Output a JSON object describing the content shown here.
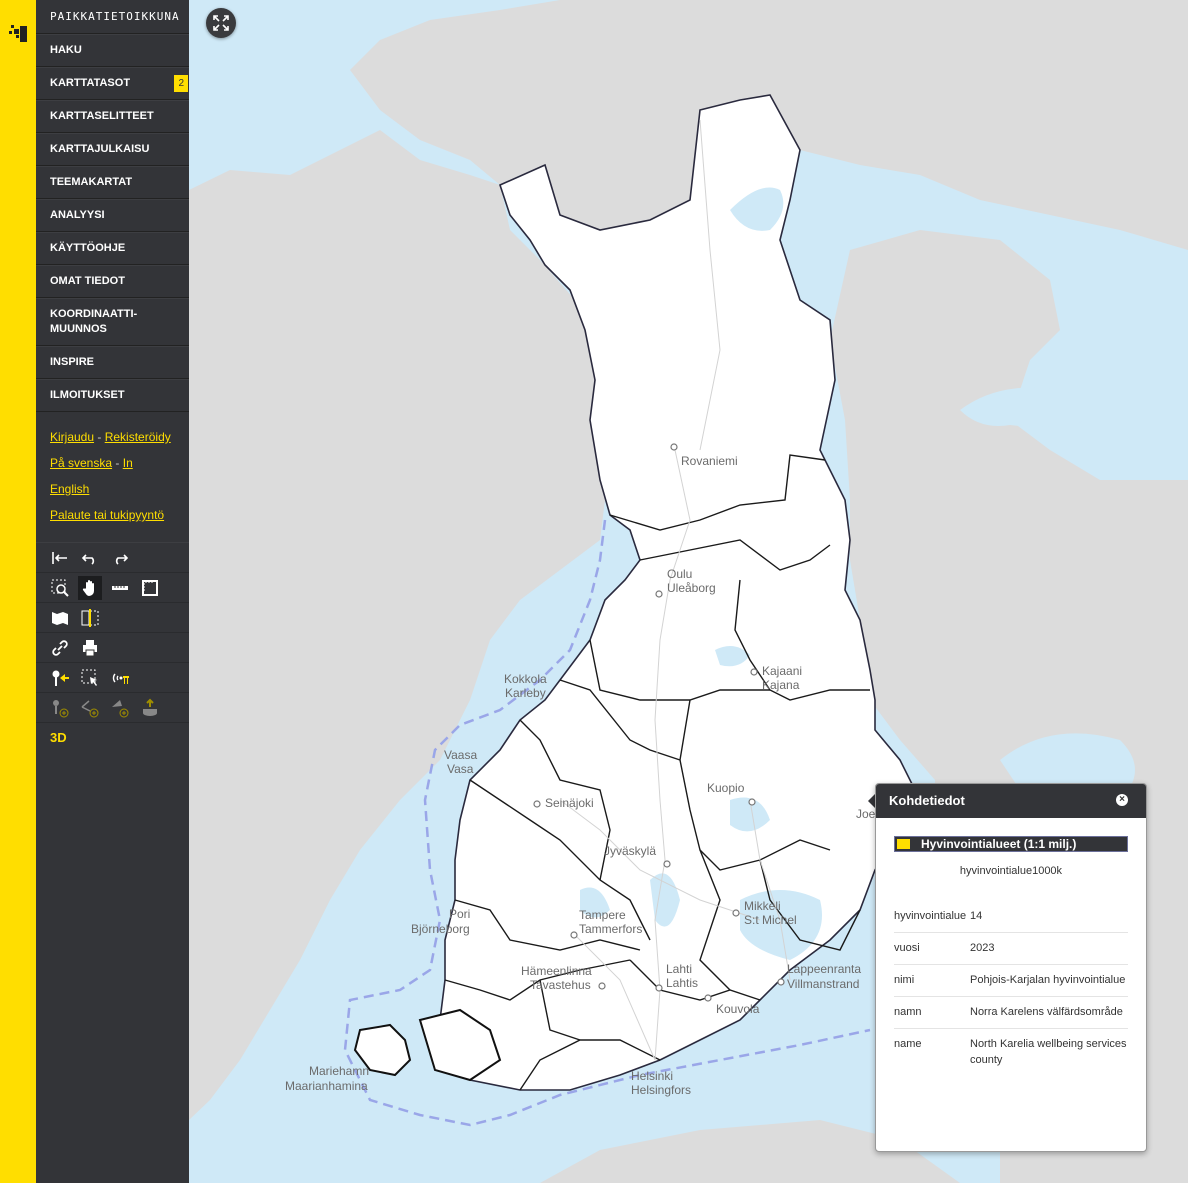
{
  "app": {
    "title": "PAIKKATIETOIKKUNA"
  },
  "menu": [
    {
      "label": "HAKU"
    },
    {
      "label": "KARTTATASOT",
      "badge": "2"
    },
    {
      "label": "KARTTASELITTEET"
    },
    {
      "label": "KARTTAJULKAISU"
    },
    {
      "label": "TEEMAKARTAT"
    },
    {
      "label": "ANALYYSI"
    },
    {
      "label": "KÄYTTÖOHJE"
    },
    {
      "label": "OMAT TIEDOT"
    },
    {
      "label": "KOORDINAATTI-\nMUUNNOS"
    },
    {
      "label": "INSPIRE"
    },
    {
      "label": "ILMOITUKSET"
    }
  ],
  "links": {
    "login": "Kirjaudu",
    "register": "Rekisteröidy",
    "swedish": "På svenska",
    "english": "In English",
    "feedback": "Palaute tai tukipyyntö",
    "separator": "-"
  },
  "tools": {
    "rows": [
      [
        "reset-view-icon",
        "undo-icon",
        "redo-icon"
      ],
      [
        "zoom-box-icon",
        "pan-hand-icon",
        "measure-line-icon",
        "measure-area-icon"
      ],
      [
        "map-book-icon",
        "split-compare-icon"
      ],
      [
        "link-icon",
        "print-icon"
      ],
      [
        "place-marker-icon",
        "select-features-icon",
        "gps-icon"
      ],
      [
        "add-point-icon",
        "add-line-icon",
        "add-area-icon",
        "import-icon"
      ]
    ],
    "three_d_label": "3D",
    "active_tool": "pan-hand-icon"
  },
  "map": {
    "cities": [
      {
        "label": "Rovaniemi"
      },
      {
        "label": "Oulu"
      },
      {
        "label": "Uleåborg"
      },
      {
        "label": "Kajaani"
      },
      {
        "label": "Kajana"
      },
      {
        "label": "Kokkola"
      },
      {
        "label": "Karleby"
      },
      {
        "label": "Vaasa"
      },
      {
        "label": "Vasa"
      },
      {
        "label": "Kuopio"
      },
      {
        "label": "Seinäjoki"
      },
      {
        "label": "Jyväskylä"
      },
      {
        "label": "Joensuu"
      },
      {
        "label": "Mikkeli"
      },
      {
        "label": "S:t Michel"
      },
      {
        "label": "Pori"
      },
      {
        "label": "Björneborg"
      },
      {
        "label": "Tampere"
      },
      {
        "label": "Tammerfors"
      },
      {
        "label": "Hämeenlinna"
      },
      {
        "label": "Tavastehus"
      },
      {
        "label": "Lahti"
      },
      {
        "label": "Lahtis"
      },
      {
        "label": "Lappeenranta"
      },
      {
        "label": "Villmanstrand"
      },
      {
        "label": "Kouvola"
      },
      {
        "label": "Helsinki"
      },
      {
        "label": "Helsingfors"
      },
      {
        "label": "Mariehamn"
      },
      {
        "label": "Maarianhamina"
      }
    ],
    "colors": {
      "sea": "#cfe9f7",
      "foreign_land": "#dcdcdc",
      "finland": "#ffffff",
      "region_border": "#1a1a1a",
      "sea_border": "#9aa6e8",
      "accent": "#ffde00"
    }
  },
  "popup": {
    "title": "Kohdetiedot",
    "layer_title": "Hyvinvointialueet (1:1 milj.)",
    "layer_id": "hyvinvointialue1000k",
    "attributes": [
      {
        "key": "hyvinvointialue",
        "value": "14"
      },
      {
        "key": "vuosi",
        "value": "2023"
      },
      {
        "key": "nimi",
        "value": "Pohjois-Karjalan hyvinvointialue"
      },
      {
        "key": "namn",
        "value": "Norra Karelens välfärdsområde"
      },
      {
        "key": "name",
        "value": "North Karelia wellbeing services county"
      }
    ]
  }
}
